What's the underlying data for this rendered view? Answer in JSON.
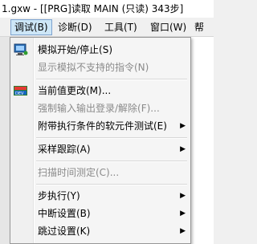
{
  "window": {
    "title": "1.gxw - [[PRG]读取 MAIN (只读) 343步]"
  },
  "menubar": {
    "items": [
      {
        "label": "调试(B)"
      },
      {
        "label": "诊断(D)"
      },
      {
        "label": "工具(T)"
      },
      {
        "label": "窗口(W)"
      },
      {
        "label": "帮"
      }
    ],
    "overflow_icon": "chevron-right-icon"
  },
  "debug_menu": {
    "items": [
      {
        "label": "模拟开始/停止(S)",
        "enabled": true,
        "submenu": false,
        "icon": "simulator-icon"
      },
      {
        "label": "显示模拟不支持的指令(N)",
        "enabled": false,
        "submenu": false
      },
      {
        "label": "当前值更改(M)...",
        "enabled": true,
        "submenu": false,
        "icon": "device-value-icon"
      },
      {
        "label": "强制输入输出登录/解除(F)...",
        "enabled": false,
        "submenu": false
      },
      {
        "label": "附带执行条件的软元件测试(E)",
        "enabled": true,
        "submenu": true
      },
      {
        "label": "采样跟踪(A)",
        "enabled": true,
        "submenu": true
      },
      {
        "label": "扫描时间测定(C)...",
        "enabled": false,
        "submenu": false
      },
      {
        "label": "步执行(Y)",
        "enabled": true,
        "submenu": true
      },
      {
        "label": "中断设置(B)",
        "enabled": true,
        "submenu": true
      },
      {
        "label": "跳过设置(K)",
        "enabled": true,
        "submenu": true
      }
    ],
    "submenu_arrow": "▶"
  }
}
